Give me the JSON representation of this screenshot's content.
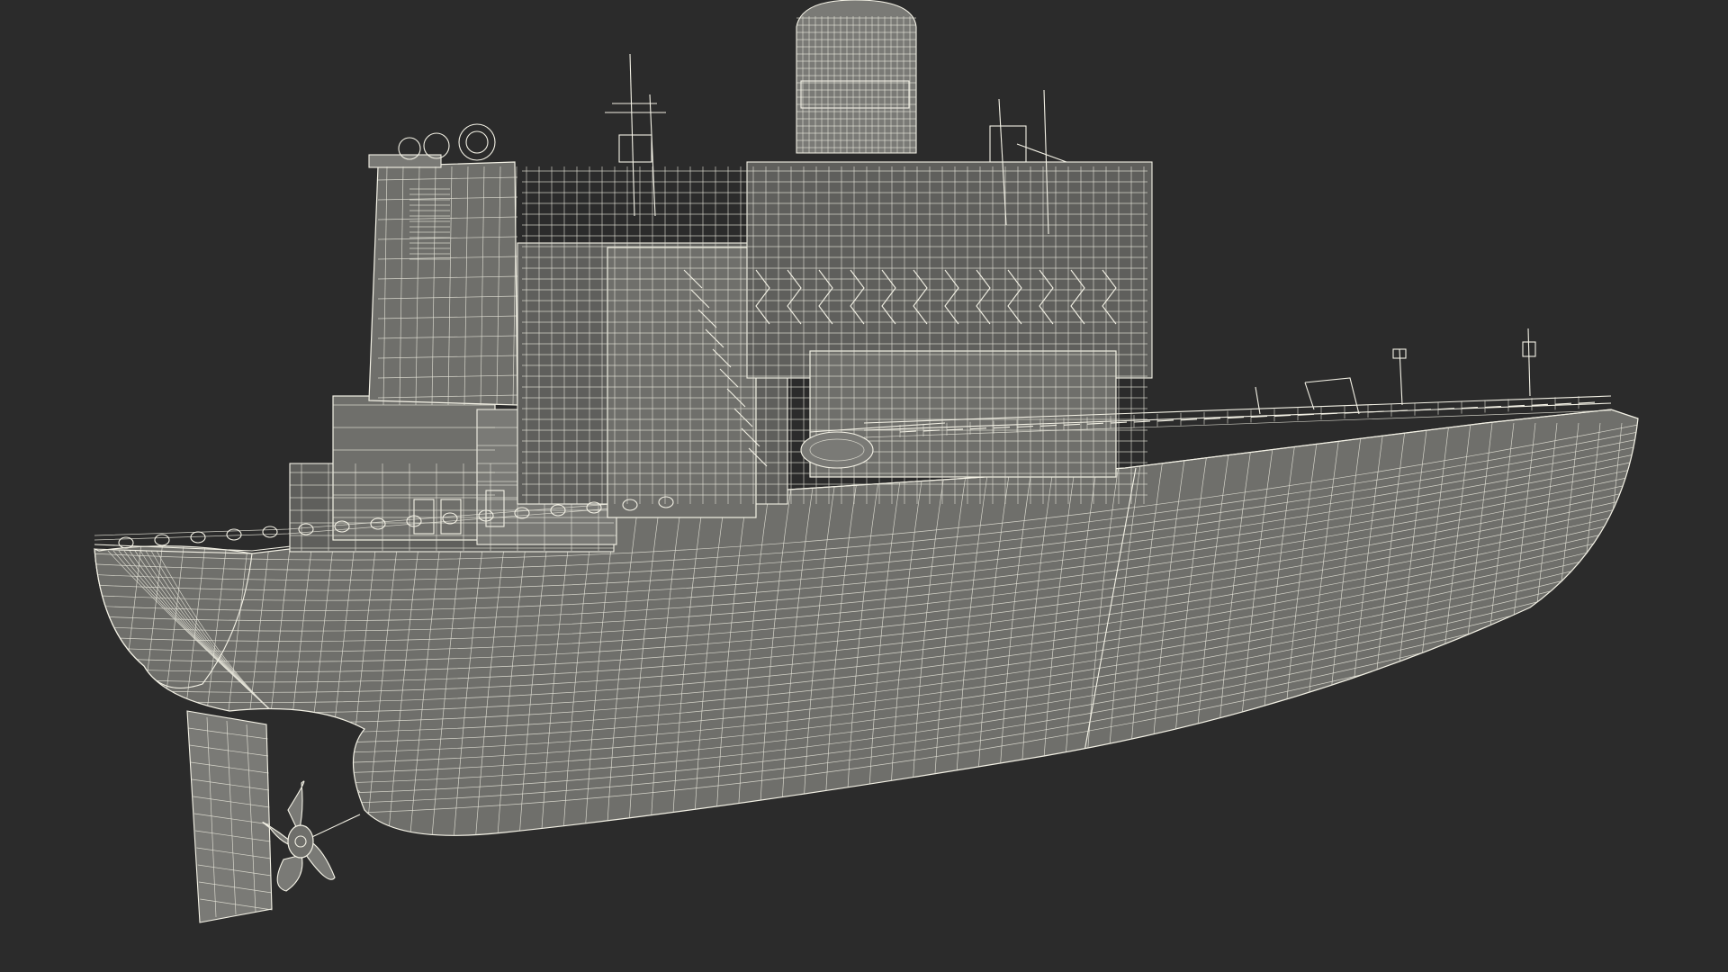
{
  "scene": {
    "subject": "wireframe-ship-model",
    "background_color": "#2b2b2b",
    "wire_color": "#f4f2e6",
    "hull_color": "#6f6f6b",
    "parts": [
      "hull",
      "rudder",
      "propeller",
      "funnel",
      "superstructure",
      "central-tower",
      "deck-equipment",
      "bow-mast"
    ]
  }
}
